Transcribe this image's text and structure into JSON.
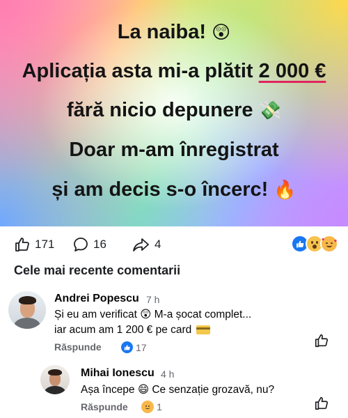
{
  "post": {
    "line1": "La naiba!",
    "line1_emoji": "😲",
    "line2_pre": "Aplicația asta mi-a plătit ",
    "line2_amount": "2 000 €",
    "line3": "fără nicio depunere",
    "line3_emoji": "💸",
    "line4": "Doar m-am înregistrat",
    "line5": "și am decis s-o încerc!",
    "line5_emoji": "🔥"
  },
  "stats": {
    "likes": "171",
    "comments": "16",
    "shares": "4",
    "reaction_icons": [
      "like-icon",
      "wow-icon",
      "love-icon"
    ]
  },
  "comments_section": {
    "title": "Cele mai recente comentarii"
  },
  "comments": [
    {
      "author": "Andrei Popescu",
      "time": "7 h",
      "line1": "Și eu am verificat 😲 M-a șocat complet...",
      "line2": "iar acum am 1 200 € pe card",
      "reply_label": "Răspunde",
      "reaction_count": "17"
    },
    {
      "author": "Mihai Ionescu",
      "time": "4 h",
      "line1": "Așa începe 😄 Ce senzație grozavă, nu?",
      "reply_label": "Răspunde",
      "reaction_count": "1"
    }
  ],
  "colors": {
    "accent": "#1877f2",
    "underline": "#e0245e",
    "muted": "#65676b"
  }
}
